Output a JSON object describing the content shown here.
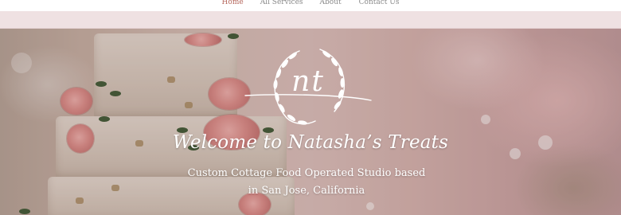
{
  "nav": {
    "items": [
      {
        "label": "Home"
      },
      {
        "label": "All Services"
      },
      {
        "label": "About"
      },
      {
        "label": "Contact Us"
      }
    ]
  },
  "hero": {
    "title": "Welcome to Natasha’s Treats",
    "subtitle_line1": "Custom Cottage Food Operated Studio based",
    "subtitle_line2": "in San Jose, California"
  },
  "logo": {
    "monogram": "nt"
  },
  "colors": {
    "nav_active": "#b5675d",
    "nav_text": "#8a8a8a",
    "band": "#efe1e2",
    "hero_text": "#ffffff"
  }
}
